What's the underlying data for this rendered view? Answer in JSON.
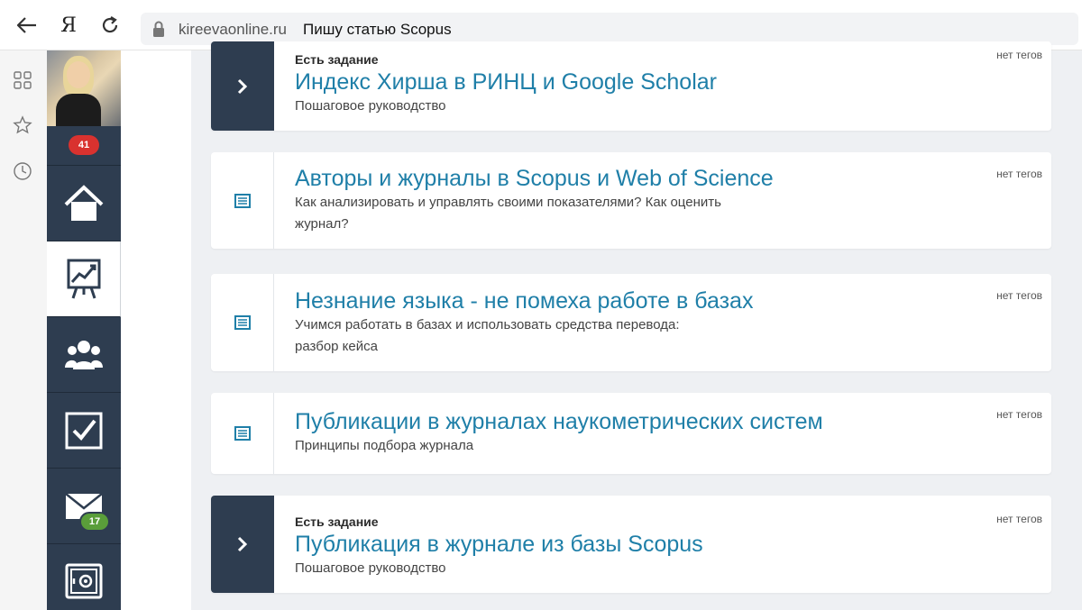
{
  "browser": {
    "yandex_glyph": "Я",
    "domain": "kireevaonline.ru",
    "page_title": "Пишу статью Scopus"
  },
  "sidebar": {
    "notifications_count": "41",
    "messages_count": "17",
    "items": [
      {
        "name": "home",
        "icon": "home-icon"
      },
      {
        "name": "progress",
        "icon": "chart-board-icon",
        "active": true
      },
      {
        "name": "users",
        "icon": "users-icon"
      },
      {
        "name": "tasks",
        "icon": "checkbox-icon"
      },
      {
        "name": "messages",
        "icon": "envelope-icon"
      },
      {
        "name": "settings",
        "icon": "safe-icon"
      }
    ]
  },
  "lessons": [
    {
      "type": "task",
      "task_label": "Есть задание",
      "title": "Индекс Хирша в РИНЦ и Google Scholar",
      "desc": "Пошаговое руководство",
      "tags": "нет тегов"
    },
    {
      "type": "article",
      "title": "Авторы и журналы в Scopus и Web of Science",
      "desc_line1": "Как анализировать и управлять своими показателями? Как оценить",
      "desc_line2": "журнал?",
      "tags": "нет тегов"
    },
    {
      "type": "article",
      "title": "Незнание языка - не помеха работе в базах",
      "desc_line1": "Учимся работать в базах и использовать средства перевода:",
      "desc_line2": "разбор кейса",
      "tags": "нет тегов"
    },
    {
      "type": "article",
      "title": "Публикации в журналах наукометрических систем",
      "desc": "Принципы подбора журнала",
      "tags": "нет тегов"
    },
    {
      "type": "task",
      "task_label": "Есть задание",
      "title": "Публикация в журнале из базы Scopus",
      "desc": "Пошаговое руководство",
      "tags": "нет тегов"
    }
  ],
  "colors": {
    "sidebar_bg": "#2e3d50",
    "link": "#1f7fa8",
    "badge_red": "#d9322f",
    "badge_green": "#5a9e3a"
  }
}
